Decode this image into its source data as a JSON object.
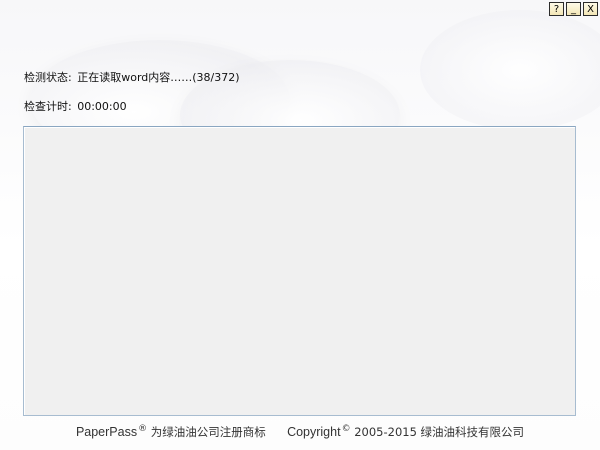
{
  "title_buttons": {
    "help_label": "?",
    "minimize_label": "_",
    "close_label": "X"
  },
  "status": {
    "detect_label": "检测状态:",
    "detect_value": "正在读取word内容……(38/372)",
    "timer_label": "检查计时:",
    "timer_value": "00:00:00"
  },
  "footer": {
    "brand_name": "PaperPass",
    "registered_mark": "®",
    "trademark_text": "为绿油油公司注册商标",
    "copyright_word": "Copyright",
    "copyright_mark": "©",
    "copyright_text": "2005-2015 绿油油科技有限公司"
  }
}
